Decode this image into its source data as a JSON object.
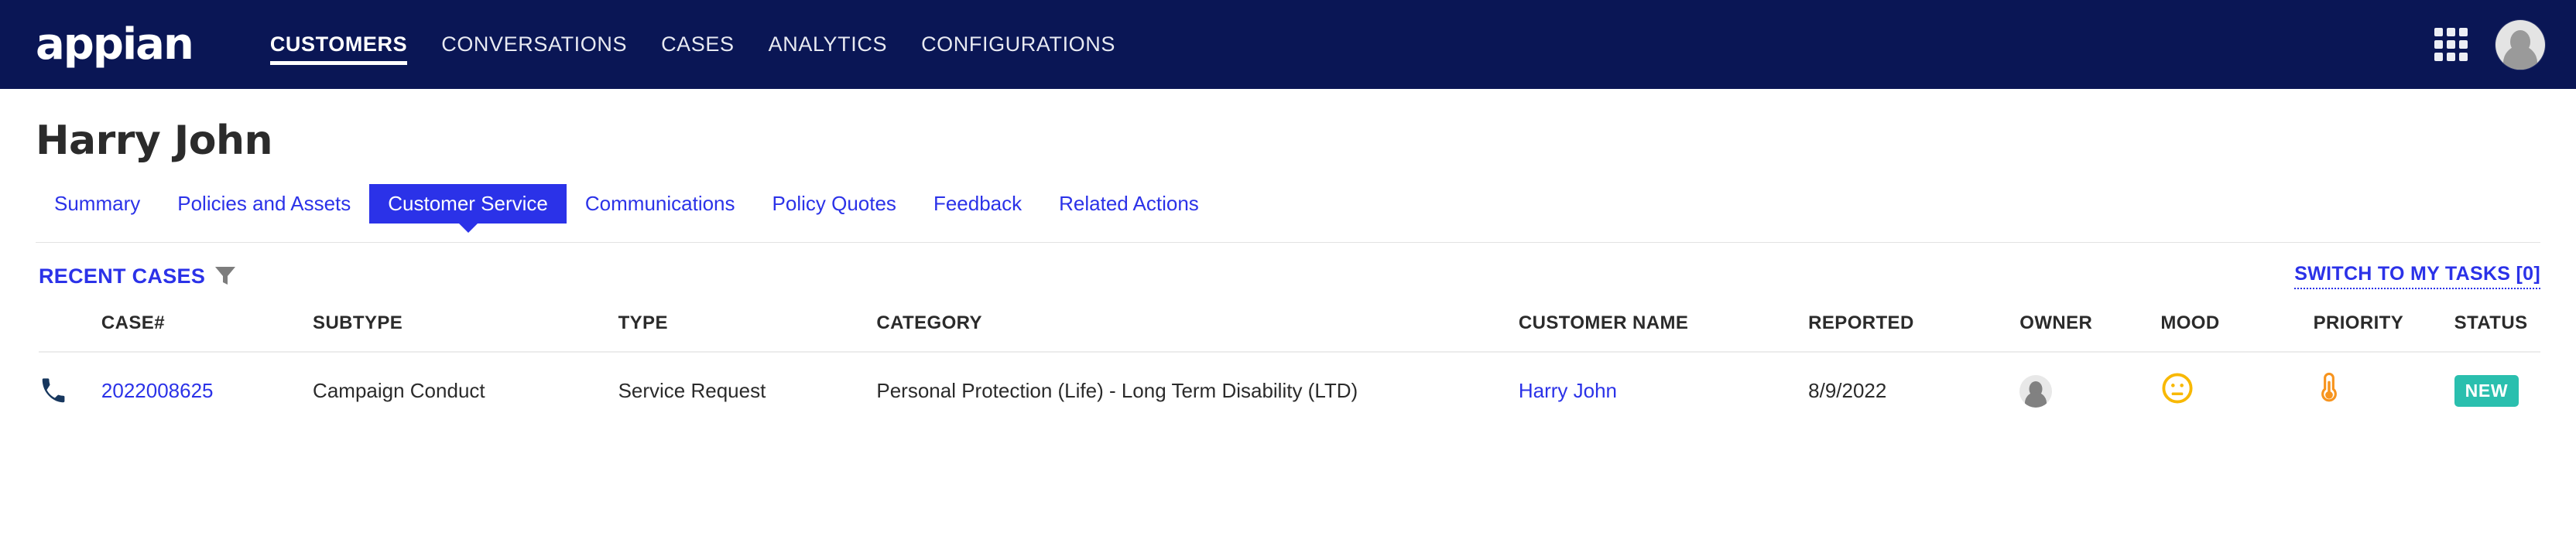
{
  "topnav": {
    "brand": "appian",
    "items": [
      {
        "label": "CUSTOMERS",
        "active": true
      },
      {
        "label": "CONVERSATIONS",
        "active": false
      },
      {
        "label": "CASES",
        "active": false
      },
      {
        "label": "ANALYTICS",
        "active": false
      },
      {
        "label": "CONFIGURATIONS",
        "active": false
      }
    ],
    "apps_icon": "grid-icon",
    "avatar_icon": "user-avatar-icon",
    "background_color": "#0a1655"
  },
  "page": {
    "title": "Harry John"
  },
  "tabs": [
    {
      "label": "Summary",
      "active": false
    },
    {
      "label": "Policies and Assets",
      "active": false
    },
    {
      "label": "Customer Service",
      "active": true
    },
    {
      "label": "Communications",
      "active": false
    },
    {
      "label": "Policy Quotes",
      "active": false
    },
    {
      "label": "Feedback",
      "active": false
    },
    {
      "label": "Related Actions",
      "active": false
    }
  ],
  "section": {
    "title": "RECENT CASES",
    "filter_icon": "funnel-filter-icon",
    "switch_link": "SWITCH TO MY TASKS [0]",
    "accent_color": "#2b32e8"
  },
  "table": {
    "columns": [
      "",
      "CASE#",
      "SUBTYPE",
      "TYPE",
      "CATEGORY",
      "CUSTOMER NAME",
      "REPORTED",
      "OWNER",
      "MOOD",
      "PRIORITY",
      "STATUS"
    ],
    "rows": [
      {
        "channel_icon": "phone-icon",
        "case_number": "2022008625",
        "subtype": "Campaign Conduct",
        "type": "Service Request",
        "category": "Personal Protection (Life) - Long Term Disability (LTD)",
        "customer_name": "Harry John",
        "reported": "8/9/2022",
        "owner_icon": "user-avatar-icon",
        "mood_icon": "neutral-face-icon",
        "mood_color": "#f8b800",
        "priority_icon": "thermometer-icon",
        "priority_color": "#f7941e",
        "status": "NEW",
        "status_color": "#2abfae"
      }
    ]
  }
}
